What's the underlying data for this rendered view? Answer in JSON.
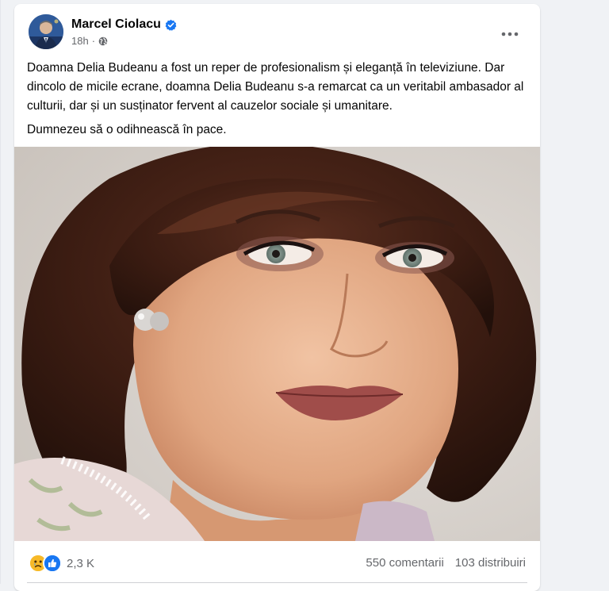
{
  "post": {
    "author_name": "Marcel Ciolacu",
    "timestamp": "18h",
    "separator": "·",
    "verified_icon": "verified-badge-icon",
    "privacy_icon": "globe-icon",
    "more_label": "•••",
    "paragraphs": [
      "Doamna Delia Budeanu a fost un reper de profesionalism și eleganță în televiziune. Dar dincolo de micile ecrane, doamna Delia Budeanu s-a remarcat ca un veritabil ambasador al culturii, dar și un susținator fervent al cauzelor sociale și umanitare.",
      "Dumnezeu să o odihnească în pace."
    ]
  },
  "footer": {
    "reactions": [
      "sad-reaction-icon",
      "like-reaction-icon"
    ],
    "reaction_count": "2,3 K",
    "comments": "550 comentarii",
    "shares": "103 distribuiri"
  },
  "colors": {
    "accent": "#1877f2",
    "secondary_text": "#65676b",
    "background": "#f0f2f5"
  }
}
